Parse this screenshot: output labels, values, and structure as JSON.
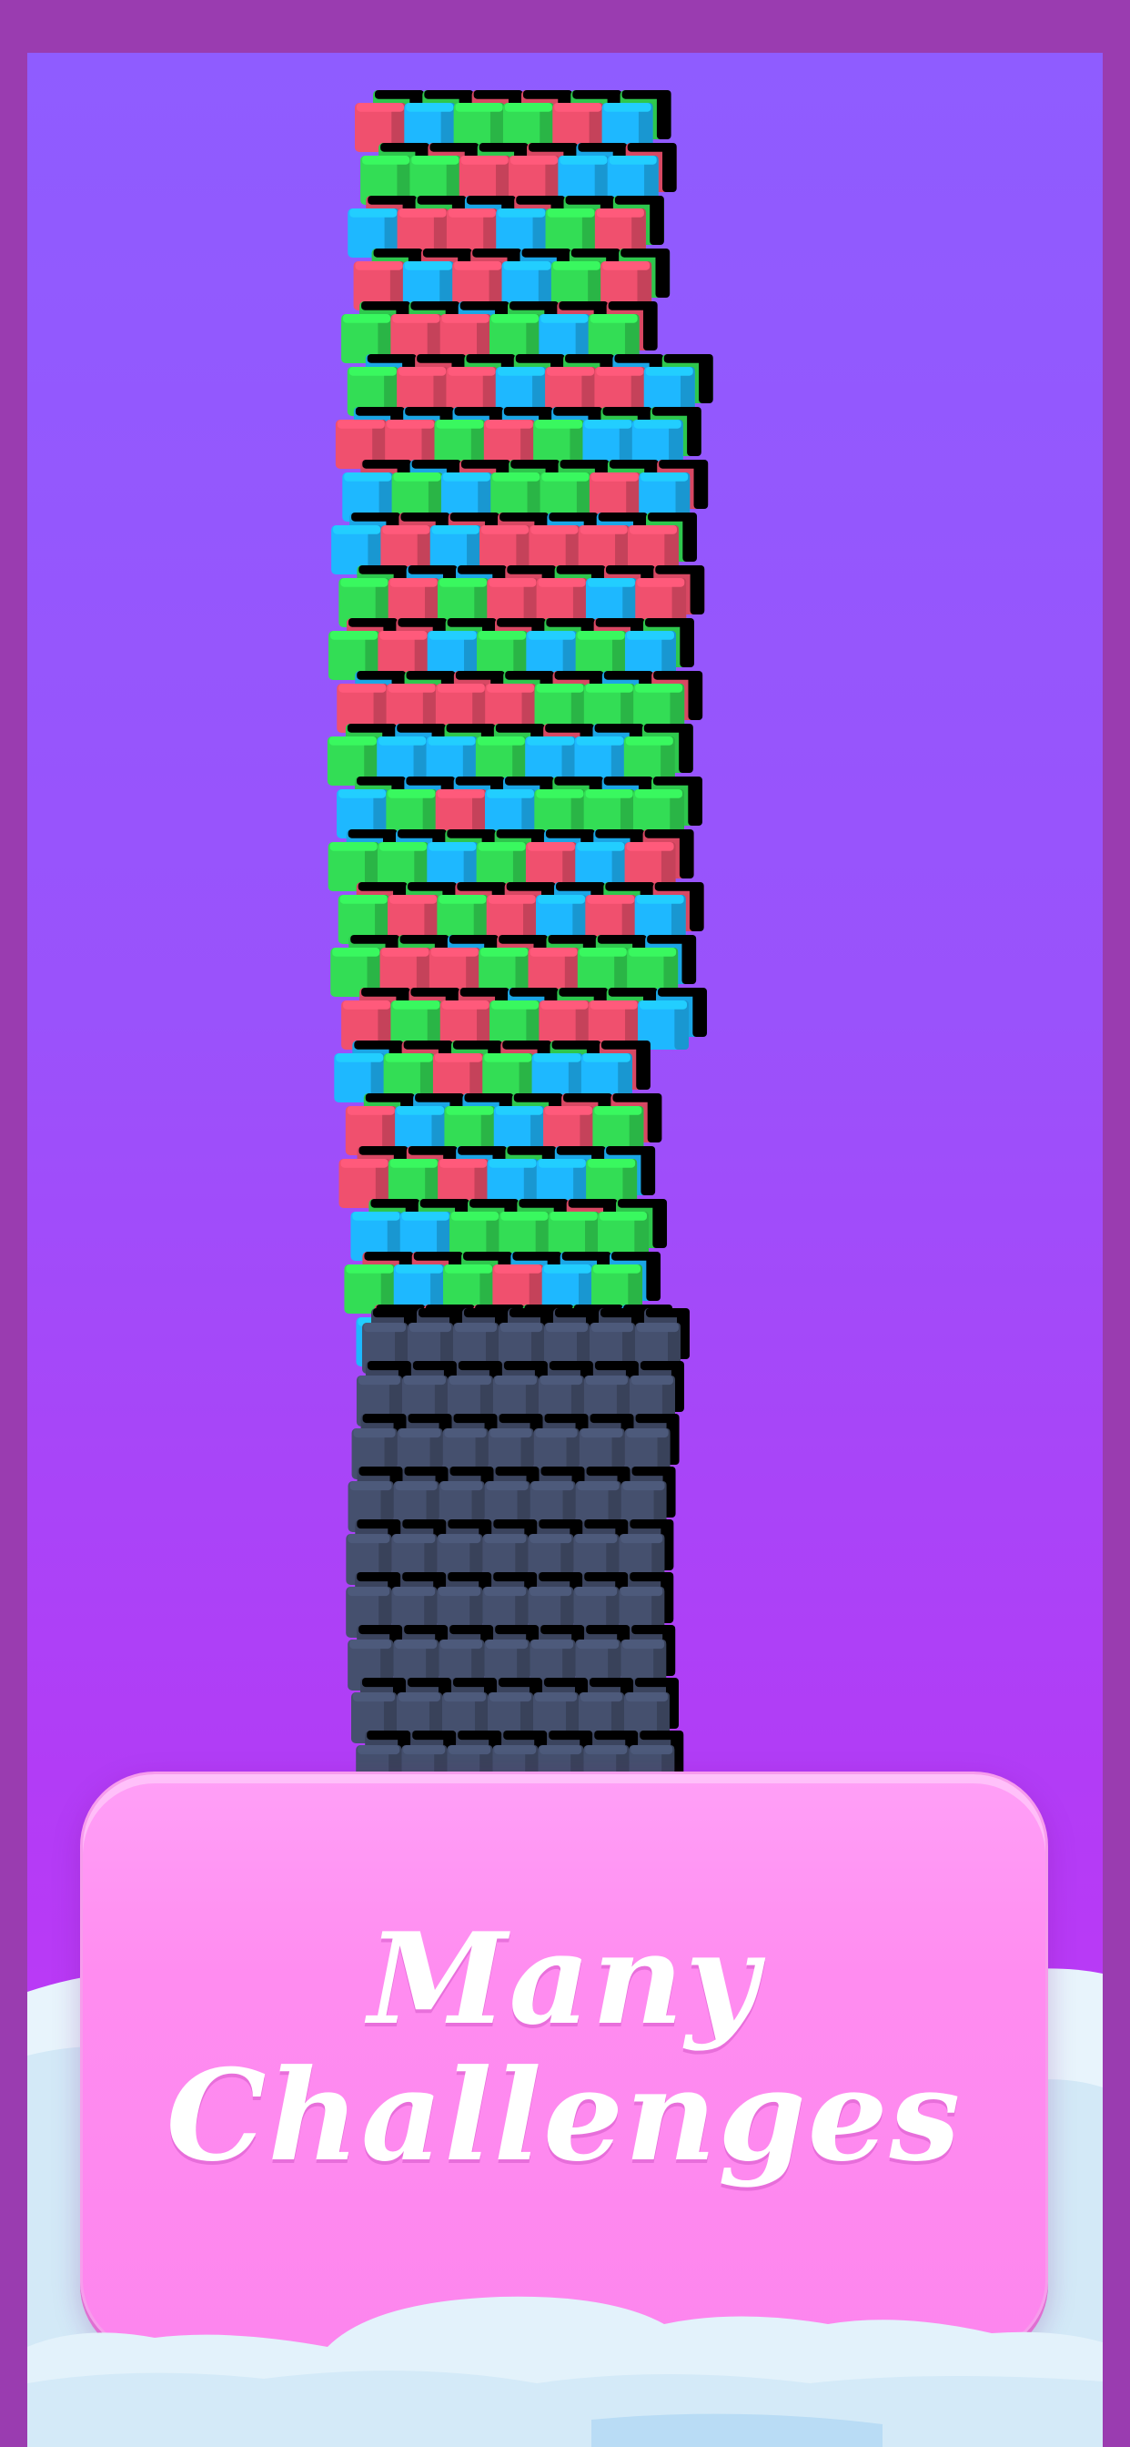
{
  "title_line1": "Many",
  "title_line2": "Challenges",
  "colors": {
    "frame": "#9a3cb0",
    "sky_top": "#8f5cff",
    "sky_bottom": "#c934f6",
    "block_red": "#f0506e",
    "block_green": "#33dd55",
    "block_blue": "#1eb8ff",
    "block_dark": "#45506e",
    "panel": "#ff8cf0",
    "cloud": "#dff0fb"
  }
}
